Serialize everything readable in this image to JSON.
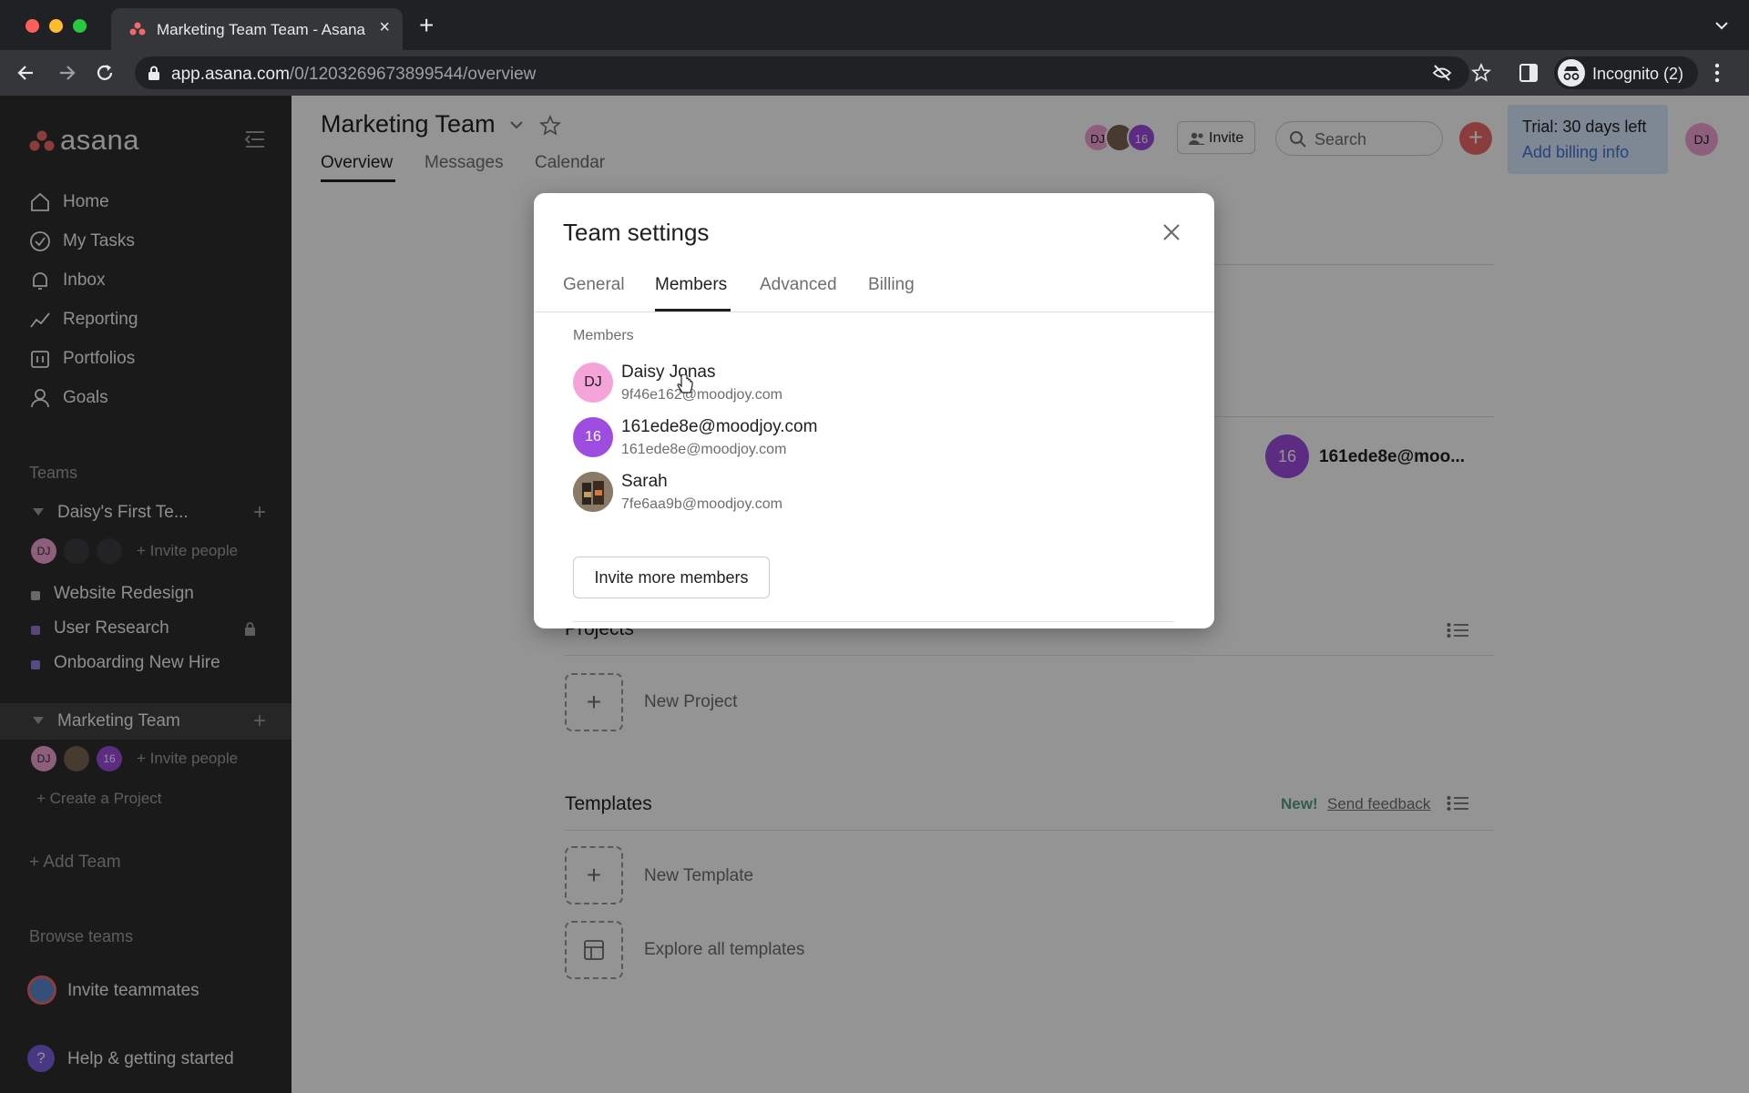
{
  "browser": {
    "tab_title": "Marketing Team Team - Asana",
    "url_host": "app.asana.com",
    "url_path": "/0/1203269673899544/overview",
    "profile_label": "Incognito (2)"
  },
  "sidebar": {
    "logo_text": "asana",
    "nav": [
      {
        "label": "Home",
        "icon": "home-icon"
      },
      {
        "label": "My Tasks",
        "icon": "check-circle-icon"
      },
      {
        "label": "Inbox",
        "icon": "bell-icon"
      },
      {
        "label": "Reporting",
        "icon": "chart-icon"
      },
      {
        "label": "Portfolios",
        "icon": "folder-icon"
      },
      {
        "label": "Goals",
        "icon": "person-icon"
      }
    ],
    "teams_heading": "Teams",
    "team1": {
      "name": "Daisy's First Te...",
      "avatar": "DJ",
      "invite": "Invite people",
      "projects": [
        {
          "name": "Website Redesign",
          "color": "#b8b6b6"
        },
        {
          "name": "User Research",
          "color": "#9a7bd1"
        },
        {
          "name": "Onboarding New Hire",
          "color": "#8d84e8"
        }
      ]
    },
    "team2": {
      "name": "Marketing Team",
      "avatars": [
        "DJ",
        "16"
      ],
      "invite": "Invite people",
      "create_project": "Create a Project"
    },
    "add_team": "Add Team",
    "browse_teams": "Browse teams",
    "invite_teammates": "Invite teammates",
    "help": "Help & getting started"
  },
  "header": {
    "title": "Marketing Team",
    "tabs": [
      "Overview",
      "Messages",
      "Calendar"
    ],
    "avatars": [
      "DJ",
      "16"
    ],
    "invite_label": "Invite",
    "search_placeholder": "Search",
    "trial_text": "Trial: 30 days left",
    "billing_link": "Add billing info",
    "user_initials": "DJ"
  },
  "main": {
    "member_chip_initials": "16",
    "member_chip_name": "161ede8e@moo...",
    "projects_title": "Projects",
    "new_project": "New Project",
    "templates_title": "Templates",
    "new_badge": "New!",
    "send_feedback": "Send feedback",
    "new_template": "New Template",
    "explore_templates": "Explore all templates"
  },
  "modal": {
    "title": "Team settings",
    "tabs": [
      "General",
      "Members",
      "Advanced",
      "Billing"
    ],
    "members_label": "Members",
    "members": [
      {
        "initials": "DJ",
        "name": "Daisy Jonas",
        "email": "9f46e162@moodjoy.com",
        "color": "#f4a4d8",
        "text_color": "#1e1f21"
      },
      {
        "initials": "16",
        "name": "161ede8e@moodjoy.com",
        "email": "161ede8e@moodjoy.com",
        "color": "#9d4de0",
        "text_color": "#ffffff"
      },
      {
        "initials": "",
        "name": "Sarah",
        "email": "7fe6aa9b@moodjoy.com",
        "color": "#6b5a4a",
        "text_color": "#ffffff"
      }
    ],
    "invite_more": "Invite more members"
  }
}
